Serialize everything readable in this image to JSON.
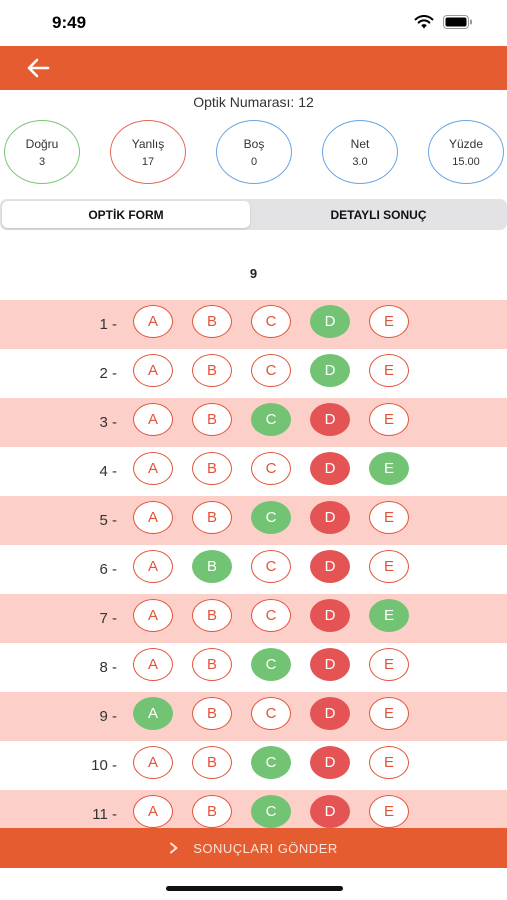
{
  "status_bar": {
    "time": "9:49"
  },
  "header": {
    "title": "Optik Numarası: 12"
  },
  "stats": [
    {
      "label": "Doğru",
      "value": "3",
      "color": "#7cc576"
    },
    {
      "label": "Yanlış",
      "value": "17",
      "color": "#e26a5a"
    },
    {
      "label": "Boş",
      "value": "0",
      "color": "#6aa6e0"
    },
    {
      "label": "Net",
      "value": "3.0",
      "color": "#6aa6e0"
    },
    {
      "label": "Yüzde",
      "value": "15.00",
      "color": "#6aa6e0"
    }
  ],
  "tabs": [
    {
      "label": "OPTİK FORM",
      "active": true
    },
    {
      "label": "DETAYLI SONUÇ",
      "active": false
    }
  ],
  "section_number": "9",
  "options": [
    "A",
    "B",
    "C",
    "D",
    "E"
  ],
  "colors": {
    "accent": "#e55c30",
    "correct": "#72c374",
    "wrong": "#e55454",
    "row_shade": "#fcd0c8"
  },
  "questions": [
    {
      "label": "1 -",
      "correct": "D",
      "wrong": null
    },
    {
      "label": "2 -",
      "correct": "D",
      "wrong": null
    },
    {
      "label": "3 -",
      "correct": "C",
      "wrong": "D"
    },
    {
      "label": "4 -",
      "correct": "E",
      "wrong": "D"
    },
    {
      "label": "5 -",
      "correct": "C",
      "wrong": "D"
    },
    {
      "label": "6 -",
      "correct": "B",
      "wrong": "D"
    },
    {
      "label": "7 -",
      "correct": "E",
      "wrong": "D"
    },
    {
      "label": "8 -",
      "correct": "C",
      "wrong": "D"
    },
    {
      "label": "9 -",
      "correct": "A",
      "wrong": "D"
    },
    {
      "label": "10 -",
      "correct": "C",
      "wrong": "D"
    },
    {
      "label": "11 -",
      "correct": "C",
      "wrong": "D"
    }
  ],
  "submit": {
    "label": "SONUÇLARI GÖNDER"
  }
}
